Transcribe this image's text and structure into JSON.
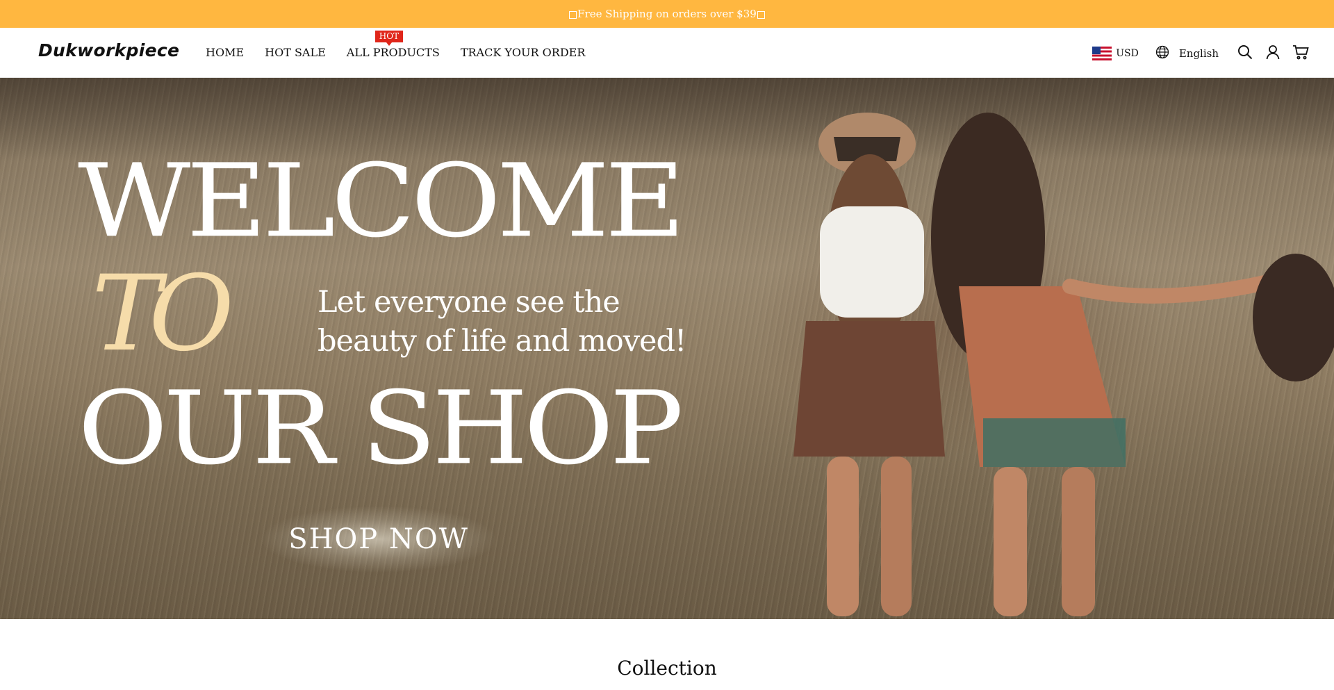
{
  "announcement": {
    "text": "Free Shipping on orders over $39"
  },
  "header": {
    "logo": "Dukworkpiece",
    "nav": [
      {
        "label": "HOME"
      },
      {
        "label": "HOT SALE"
      },
      {
        "label": "ALL PRODUCTS",
        "badge": "HOT"
      },
      {
        "label": "TRACK YOUR ORDER"
      }
    ],
    "currency": "USD",
    "language": "English",
    "icons": [
      "flag-us-icon",
      "globe-icon",
      "search-icon",
      "account-icon",
      "cart-icon"
    ]
  },
  "hero": {
    "line1": "WELCOME",
    "line2": "TO",
    "line3": "OUR SHOP",
    "tagline1": "Let everyone see the",
    "tagline2": "beauty of life and moved!",
    "cta": "SHOP NOW"
  },
  "section": {
    "title": "Collection"
  },
  "colors": {
    "announcement_bg": "#ffb740",
    "hot_badge": "#e0261a",
    "script_accent": "#f6dcaa"
  }
}
